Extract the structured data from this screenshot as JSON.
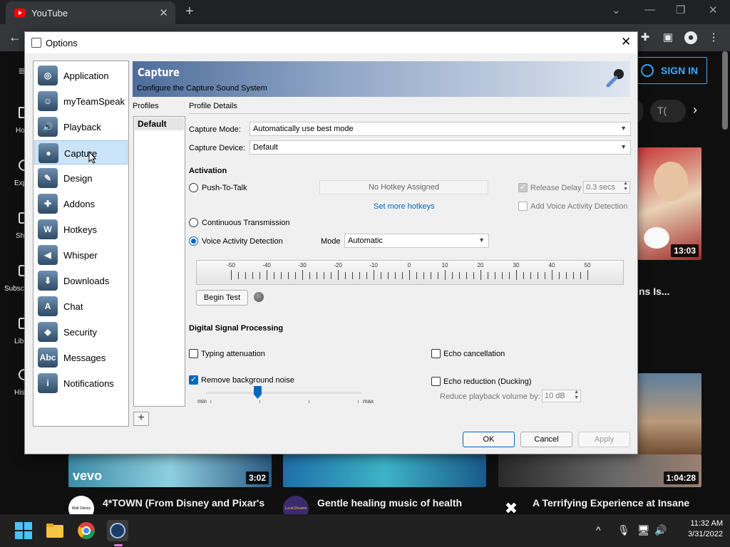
{
  "browser": {
    "tab_title": "YouTube",
    "new_tab": "+",
    "minimize": "⌄",
    "maximize": "—",
    "restore": "❐",
    "close": "✕"
  },
  "youtube": {
    "sign_in": "SIGN IN",
    "chip_partial": "T(",
    "left_nav": [
      "Ho",
      "Exp",
      "Sh",
      "Subscr",
      "Lib",
      "His"
    ],
    "videos": [
      {
        "title": "ns Is...",
        "duration": "13:03"
      },
      {
        "title": "4*TOWN (From Disney and Pixar's",
        "duration": "3:02",
        "thumb_text": "vevo",
        "channel_text": "Walt Disney"
      },
      {
        "title": "Gentle healing music of health",
        "duration": "",
        "channel_text": "Lucid Dreams"
      },
      {
        "title": "A Terrifying Experience at Insane",
        "duration": "1:04:28"
      }
    ]
  },
  "dialog": {
    "title": "Options",
    "close": "✕",
    "nav": [
      {
        "label": "Application",
        "icon": "application-icon"
      },
      {
        "label": "myTeamSpeak",
        "icon": "myteamspeak-icon"
      },
      {
        "label": "Playback",
        "icon": "speaker-icon"
      },
      {
        "label": "Capture",
        "icon": "microphone-icon",
        "selected": true
      },
      {
        "label": "Design",
        "icon": "design-icon"
      },
      {
        "label": "Addons",
        "icon": "puzzle-icon"
      },
      {
        "label": "Hotkeys",
        "icon": "hotkeys-icon"
      },
      {
        "label": "Whisper",
        "icon": "whisper-icon"
      },
      {
        "label": "Downloads",
        "icon": "download-icon"
      },
      {
        "label": "Chat",
        "icon": "chat-icon"
      },
      {
        "label": "Security",
        "icon": "shield-icon"
      },
      {
        "label": "Messages",
        "icon": "messages-icon"
      },
      {
        "label": "Notifications",
        "icon": "info-icon"
      }
    ],
    "header": {
      "title": "Capture",
      "subtitle": "Configure the Capture Sound System"
    },
    "profiles_label": "Profiles",
    "profile_details_label": "Profile Details",
    "profiles": [
      "Default"
    ],
    "add_profile": "+",
    "capture_mode": {
      "label": "Capture Mode:",
      "value": "Automatically use best mode"
    },
    "capture_device": {
      "label": "Capture Device:",
      "value": "Default"
    },
    "activation": {
      "heading": "Activation",
      "push_to_talk": "Push-To-Talk",
      "no_hotkey": "No Hotkey Assigned",
      "set_more_hotkeys": "Set more hotkeys",
      "release_delay": "Release Delay",
      "release_delay_value": "0.3 secs",
      "add_vad": "Add Voice Activity Detection",
      "continuous": "Continuous Transmission",
      "vad": "Voice Activity Detection",
      "selected": "vad",
      "mode_label": "Mode",
      "mode_value": "Automatic"
    },
    "meter": {
      "ticks": [
        "-50",
        "-40",
        "-30",
        "-20",
        "-10",
        "0",
        "10",
        "20",
        "30",
        "40",
        "50"
      ],
      "begin_test": "Begin Test"
    },
    "dsp": {
      "heading": "Digital Signal Processing",
      "typing_attenuation": "Typing attenuation",
      "typing_attenuation_checked": false,
      "echo_cancellation": "Echo cancellation",
      "echo_cancellation_checked": false,
      "remove_noise": "Remove background noise",
      "remove_noise_checked": true,
      "noise_level": 0.33,
      "slider_min": "min",
      "slider_max": "max",
      "echo_reduction": "Echo reduction (Ducking)",
      "echo_reduction_checked": false,
      "reduce_playback": "Reduce playback volume by:",
      "reduce_playback_value": "10 dB"
    },
    "buttons": {
      "ok": "OK",
      "cancel": "Cancel",
      "apply": "Apply"
    }
  },
  "taskbar": {
    "time": "11:32 AM",
    "date": "3/31/2022",
    "chevron": "^"
  },
  "colors": {
    "accent": "#0067c0",
    "selection": "#cce4f7",
    "youtube_red": "#ff0000"
  }
}
